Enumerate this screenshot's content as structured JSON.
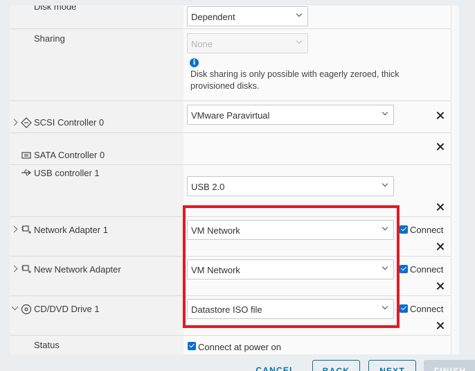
{
  "rows": {
    "disk_mode": {
      "label": "Disk mode",
      "value": "Dependent"
    },
    "sharing": {
      "label": "Sharing",
      "value": "None",
      "info_icon": "i",
      "note": "Disk sharing is only possible with eagerly zeroed, thick provisioned disks."
    },
    "scsi": {
      "label": "SCSI Controller 0",
      "value": "VMware Paravirtual"
    },
    "sata": {
      "label": "SATA Controller 0"
    },
    "usb": {
      "label": "USB controller 1",
      "value": "USB 2.0"
    },
    "net1": {
      "label": "Network Adapter 1",
      "value": "VM Network",
      "connect_label": "Connect",
      "connected": true
    },
    "net_new": {
      "label": "New Network Adapter",
      "value": "VM Network",
      "connect_label": "Connect",
      "connected": true
    },
    "cddvd": {
      "label": "CD/DVD Drive 1",
      "value": "Datastore ISO file",
      "connect_label": "Connect",
      "connected": true
    },
    "status": {
      "label": "Status",
      "checkbox_label": "Connect at power on",
      "checked": true
    }
  },
  "footer": {
    "cancel": "CANCEL",
    "back": "BACK",
    "next": "NEXT",
    "finish": "FINISH"
  },
  "colors": {
    "highlight": "#e01b24",
    "accent": "#0a6ed1",
    "link": "#0072a3"
  }
}
